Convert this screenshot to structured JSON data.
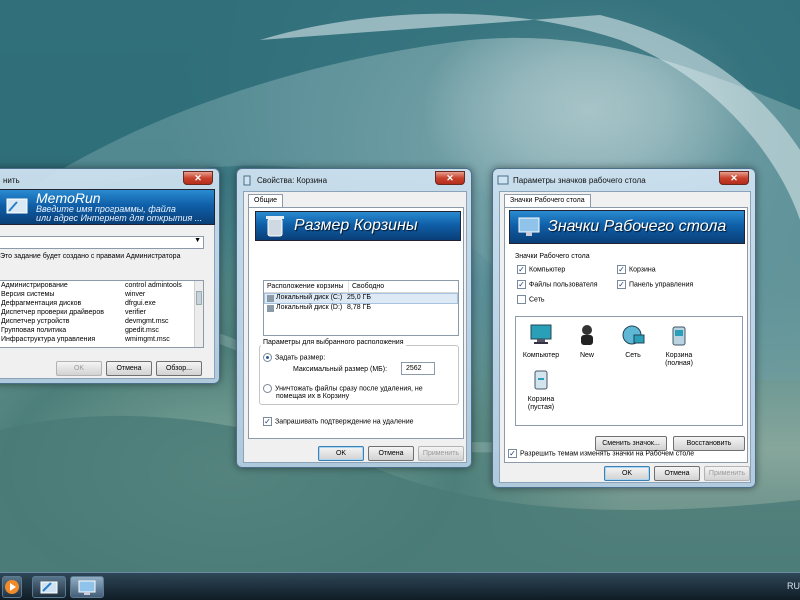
{
  "run_dialog": {
    "title": "нить",
    "banner_title": "MemoRun",
    "banner_line1": "Введите имя программы, файла",
    "banner_line2": "или адрес Интернет для открытия ...",
    "admin_note": "Это задание будет создано с правами Администратора",
    "commands": [
      {
        "name": "Администрирование",
        "cmd": "control admintools"
      },
      {
        "name": "Версия системы",
        "cmd": "winver"
      },
      {
        "name": "Дефрагментация дисков",
        "cmd": "dfrgui.exe"
      },
      {
        "name": "Диспетчер проверки драйверов",
        "cmd": "verifier"
      },
      {
        "name": "Диспетчер устройств",
        "cmd": "devmgmt.msc"
      },
      {
        "name": "Групповая политика",
        "cmd": "gpedit.msc"
      },
      {
        "name": "Инфраструктура управления",
        "cmd": "wmimgmt.msc"
      }
    ],
    "ok_label": "OK",
    "cancel_label": "Отмена",
    "browse_label": "Обзор..."
  },
  "recycle_dialog": {
    "title": "Свойства: Корзина",
    "tab_general": "Общие",
    "banner_title": "Размер Корзины",
    "col_location": "Расположение корзины",
    "col_free": "Свободно",
    "drives": [
      {
        "name": "Локальный диск (C:)",
        "free": "25,0 ГБ"
      },
      {
        "name": "Локальный диск (D:)",
        "free": "8,78 ГБ"
      }
    ],
    "group_title": "Параметры для выбранного расположения",
    "radio_custom": "Задать размер:",
    "max_size_label": "Максимальный размер (МБ):",
    "max_size_value": "2562",
    "radio_delete_line1": "Уничтожать файлы сразу после удаления, не",
    "radio_delete_line2": "помещая их в Корзину",
    "confirm_label": "Запрашивать подтверждение на удаление",
    "ok_label": "OK",
    "cancel_label": "Отмена",
    "apply_label": "Применить"
  },
  "icons_dialog": {
    "title": "Параметры значков рабочего стола",
    "tab_label": "Значки Рабочего стола",
    "banner_title": "Значки Рабочего стола",
    "group_title": "Значки Рабочего стола",
    "checkbox_computer": "Компьютер",
    "checkbox_recycle": "Корзина",
    "checkbox_user_files": "Файлы пользователя",
    "checkbox_control_panel": "Панель управления",
    "checkbox_network": "Сеть",
    "icon_computer": "Компьютер",
    "icon_new": "New",
    "icon_network": "Сеть",
    "icon_recycle_full_1": "Корзина",
    "icon_recycle_full_2": "(полная)",
    "icon_recycle_empty_1": "Корзина",
    "icon_recycle_empty_2": "(пустая)",
    "change_icon_label": "Сменить значок...",
    "restore_label": "Восстановить",
    "allow_themes_label": "Разрешить темам изменять значки на Рабочем столе",
    "ok_label": "OK",
    "cancel_label": "Отмена",
    "apply_label": "Применить"
  },
  "taskbar": {
    "language": "RU"
  }
}
